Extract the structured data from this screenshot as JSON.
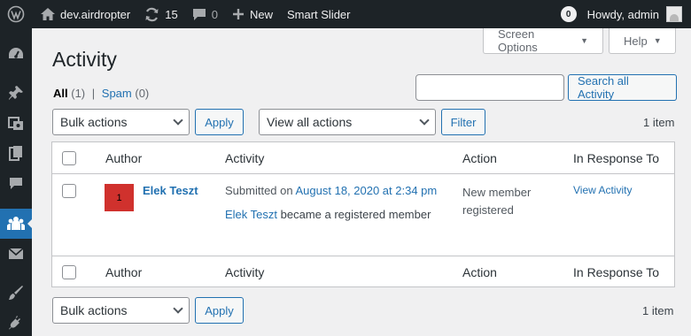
{
  "adminbar": {
    "site_name": "dev.airdropter",
    "updates_count": "15",
    "comments_count": "0",
    "new_label": "New",
    "smart_slider_label": "Smart Slider",
    "notifications_count": "0",
    "greeting": "Howdy, admin"
  },
  "screen_options": "Screen Options",
  "help": "Help",
  "page": {
    "title": "Activity",
    "filters": {
      "all_label": "All",
      "all_count": "(1)",
      "separator": "|",
      "spam_label": "Spam",
      "spam_count": "(0)"
    }
  },
  "search": {
    "value": "",
    "button": "Search all Activity"
  },
  "top_controls": {
    "bulk_select": "Bulk actions",
    "apply": "Apply",
    "actions_select": "View all actions",
    "filter": "Filter",
    "item_count": "1 item"
  },
  "table": {
    "headers": {
      "author": "Author",
      "activity": "Activity",
      "action": "Action",
      "in_response_to": "In Response To"
    },
    "rows": [
      {
        "avatar_text": "1",
        "author": "Elek Teszt",
        "submitted_prefix": "Submitted on ",
        "submitted_date": "August 18, 2020 at 2:34 pm",
        "activity_link": "Elek Teszt",
        "activity_text": " became a registered member",
        "action": "New member registered",
        "in_response": "View Activity"
      }
    ]
  },
  "bottom_controls": {
    "bulk_select": "Bulk actions",
    "apply": "Apply",
    "item_count": "1 item"
  },
  "colors": {
    "adminbar_bg": "#1d2327",
    "accent": "#2271b1",
    "avatar_bg": "#d0312d"
  }
}
